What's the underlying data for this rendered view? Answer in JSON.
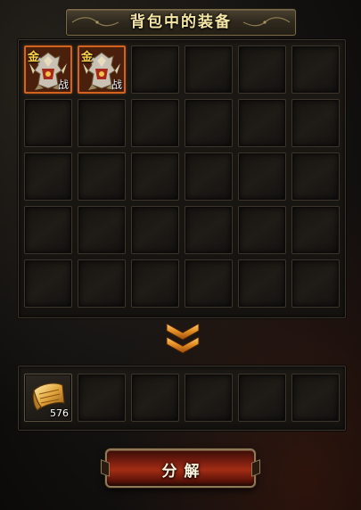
{
  "window": {
    "title": "背包中的装备"
  },
  "bag_grid": {
    "columns": 6,
    "rows": 5,
    "items": [
      {
        "icon": "gold-armor-warrior-icon",
        "quality_tag": "金",
        "class_tag": "战"
      },
      {
        "icon": "gold-armor-warrior-icon",
        "quality_tag": "金",
        "class_tag": "战"
      },
      null,
      null,
      null,
      null,
      null,
      null,
      null,
      null,
      null,
      null,
      null,
      null,
      null,
      null,
      null,
      null,
      null,
      null,
      null,
      null,
      null,
      null,
      null,
      null,
      null,
      null,
      null,
      null
    ]
  },
  "arrow": {
    "icon": "double-chevron-down-icon"
  },
  "result_grid": {
    "columns": 6,
    "items": [
      {
        "icon": "gold-scroll-material-icon",
        "count": "576"
      },
      null,
      null,
      null,
      null,
      null
    ]
  },
  "action": {
    "label": "分解"
  },
  "colors": {
    "title_text": "#f5e6a6",
    "equip_border": "#d2631e",
    "button_red": "#a32d14",
    "quality_gold": "#ffd24a"
  }
}
